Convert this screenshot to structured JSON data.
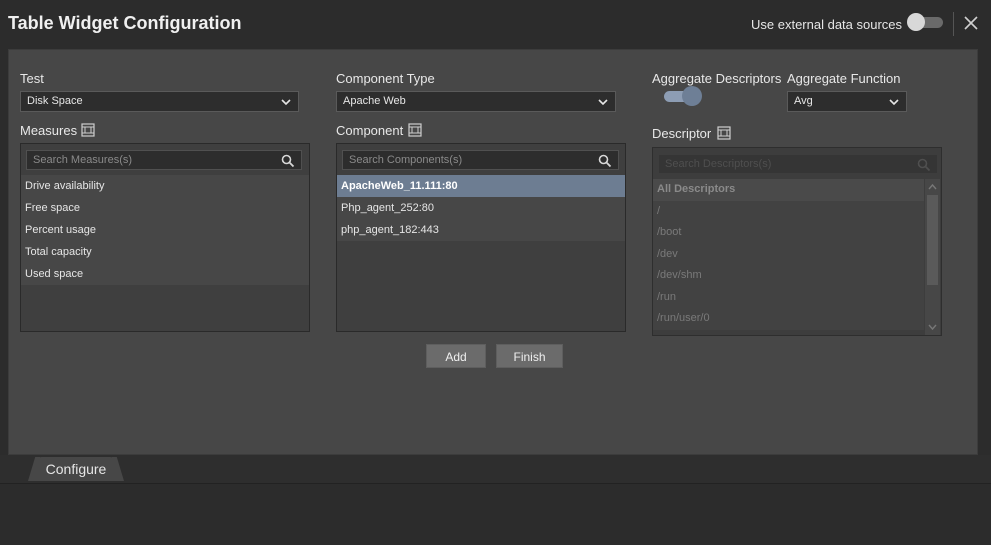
{
  "header": {
    "title": "Table Widget Configuration",
    "external_label": "Use external data sources"
  },
  "test": {
    "label": "Test",
    "value": "Disk Space"
  },
  "component_type": {
    "label": "Component Type",
    "value": "Apache Web"
  },
  "aggregate": {
    "descriptors_label": "Aggregate Descriptors",
    "function_label": "Aggregate Function",
    "function_value": "Avg",
    "toggle_on": true
  },
  "measures": {
    "label": "Measures",
    "search_placeholder": "Search Measures(s)",
    "items": [
      "Drive availability",
      "Free space",
      "Percent usage",
      "Total capacity",
      "Used space"
    ]
  },
  "component": {
    "label": "Component",
    "search_placeholder": "Search Components(s)",
    "items": [
      "ApacheWeb_11.111:80",
      "Php_agent_252:80",
      "php_agent_182:443"
    ],
    "selected_index": 0
  },
  "descriptor": {
    "label": "Descriptor",
    "search_placeholder": "Search Descriptors(s)",
    "items": [
      "All Descriptors",
      "/",
      "/boot",
      "/dev",
      "/dev/shm",
      "/run",
      "/run/user/0"
    ]
  },
  "buttons": {
    "add": "Add",
    "finish": "Finish"
  },
  "tabs": {
    "configure": "Configure"
  },
  "colors": {
    "accent": "#6d7d92",
    "panel": "#474747",
    "background": "#2c2c2c"
  }
}
